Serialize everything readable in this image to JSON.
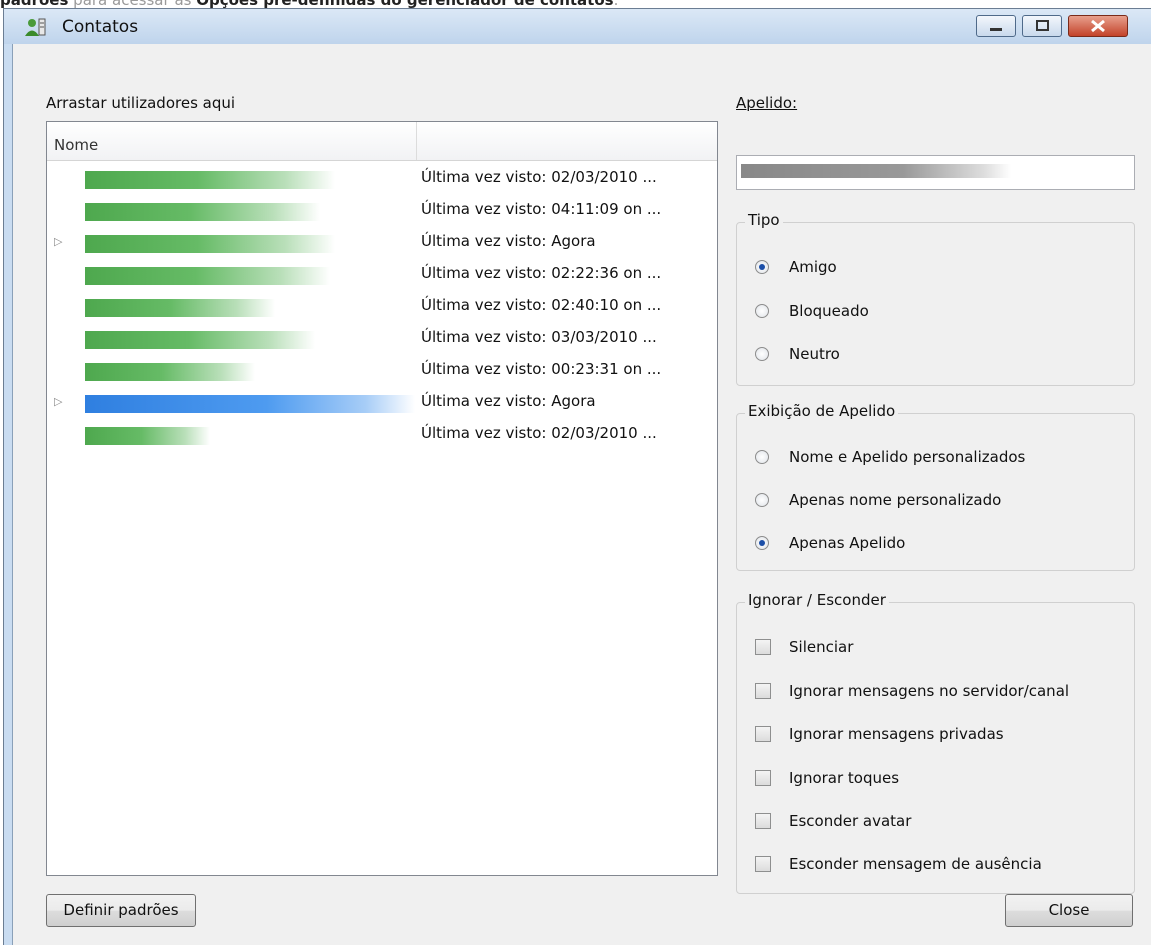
{
  "caption": {
    "pre": "padrões",
    "mid": " para acessar as ",
    "bold": "Opções pré-definidas do gerenciador de contatos",
    "post": "."
  },
  "window": {
    "title": "Contatos",
    "buttons": {
      "minimize": "minimize",
      "maximize": "maximize",
      "close": "close"
    }
  },
  "list": {
    "drag_label": "Arrastar utilizadores aqui",
    "columns": [
      "Nome",
      ""
    ],
    "rows": [
      {
        "seen": "Última vez visto: 02/03/2010 ...",
        "expandable": false,
        "selected": false
      },
      {
        "seen": "Última vez visto: 04:11:09 on ...",
        "expandable": false,
        "selected": false
      },
      {
        "seen": "Última vez visto: Agora",
        "expandable": true,
        "selected": false
      },
      {
        "seen": "Última vez visto: 02:22:36 on ...",
        "expandable": false,
        "selected": false
      },
      {
        "seen": "Última vez visto: 02:40:10 on ...",
        "expandable": false,
        "selected": false
      },
      {
        "seen": "Última vez visto: 03/03/2010 ...",
        "expandable": false,
        "selected": false
      },
      {
        "seen": "Última vez visto: 00:23:31 on ...",
        "expandable": false,
        "selected": false
      },
      {
        "seen": "Última vez visto: Agora",
        "expandable": true,
        "selected": true
      },
      {
        "seen": "Última vez visto: 02/03/2010 ...",
        "expandable": false,
        "selected": false
      }
    ]
  },
  "nickname": {
    "label": "Apelido:",
    "value": ""
  },
  "tipo": {
    "legend": "Tipo",
    "options": [
      "Amigo",
      "Bloqueado",
      "Neutro"
    ],
    "selected": "Amigo"
  },
  "exibicao": {
    "legend": "Exibição de Apelido",
    "options": [
      "Nome e Apelido personalizados",
      "Apenas nome personalizado",
      "Apenas Apelido"
    ],
    "selected": "Apenas Apelido"
  },
  "ignorar": {
    "legend": "Ignorar / Esconder",
    "options": [
      "Silenciar",
      "Ignorar mensagens no servidor/canal",
      "Ignorar mensagens privadas",
      "Ignorar toques",
      "Esconder avatar",
      "Esconder mensagem de ausência"
    ]
  },
  "buttons": {
    "defaults": "Definir padrões",
    "close": "Close"
  },
  "colors": {
    "selection": "#3a8ee6",
    "window_frame": "#c9dcf1",
    "close_button": "#c3432a"
  }
}
